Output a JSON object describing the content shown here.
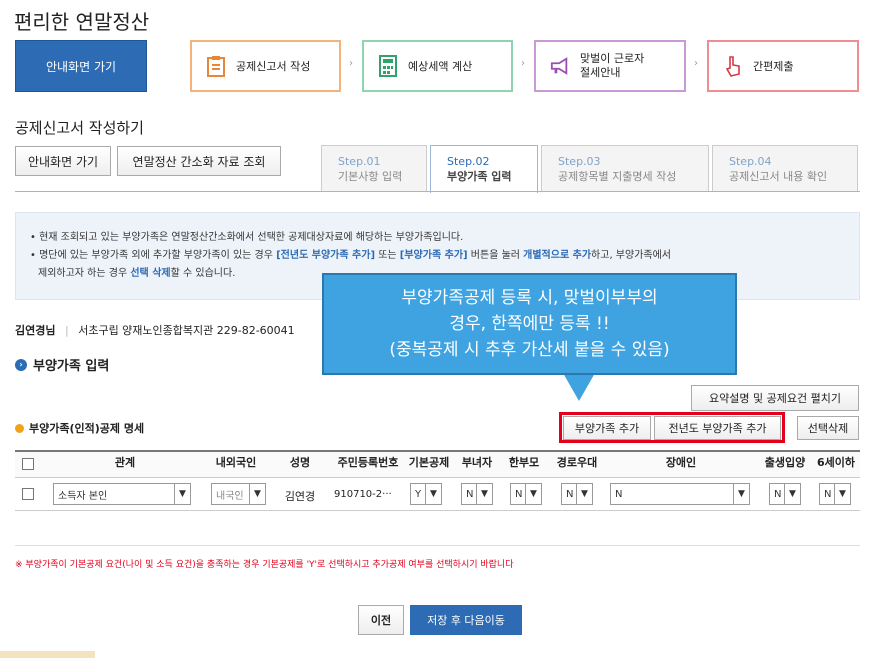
{
  "page_title": "편리한 연말정산",
  "home_button": "안내화면 가기",
  "top_steps": [
    {
      "label": "공제신고서 작성",
      "icon": "document-icon",
      "color": "#f5b27a"
    },
    {
      "label": "예상세액 계산",
      "icon": "calculator-icon",
      "color": "#8fd4b0"
    },
    {
      "label": "맞벌이 근로자\n절세안내",
      "icon": "megaphone-icon",
      "color": "#c99ad6"
    },
    {
      "label": "간편제출",
      "icon": "pointer-hand-icon",
      "color": "#ef8d93"
    }
  ],
  "section_title": "공제신고서 작성하기",
  "action_buttons": {
    "guide": "안내화면 가기",
    "lookup": "연말정산 간소화 자료 조회"
  },
  "tabs": [
    {
      "step": "Step.01",
      "label": "기본사항 입력",
      "active": false
    },
    {
      "step": "Step.02",
      "label": "부양가족 입력",
      "active": true
    },
    {
      "step": "Step.03",
      "label": "공제항목별 지출명세 작성",
      "active": false
    },
    {
      "step": "Step.04",
      "label": "공제신고서 내용 확인",
      "active": false
    }
  ],
  "info": {
    "line1": "현재 조회되고 있는 부양가족은 연말정산간소화에서 선택한 공제대상자료에 해당하는 부양가족입니다.",
    "line2_a": "명단에 있는 부양가족 외에 추가할 부양가족이 있는 경우 ",
    "line2_b": "[전년도 부양가족 추가]",
    "line2_c": " 또는 ",
    "line2_d": "[부양가족 추가]",
    "line2_e": " 버튼을 눌러 ",
    "line2_f": "개별적으로 추가",
    "line2_g": "하고, 부양가족에서",
    "line3_a": "제외하고자 하는 경우 ",
    "line3_b": "선택 삭제",
    "line3_c": "할 수 있습니다."
  },
  "callout": {
    "line1": "부양가족공제 등록 시, 맞벌이부부의",
    "line2": "경우, 한쪽에만 등록 !!",
    "line3": "(중복공제 시 추후 가산세 붙을 수 있음)"
  },
  "user": {
    "name": "김연경님",
    "company": "서초구립 양재노인종합복지관 229-82-60041"
  },
  "dependents_heading": "부양가족 입력",
  "summary_button": "요약설명 및 공제요건 펼치기",
  "table_title": "부양가족(인적)공제 명세",
  "table_buttons": {
    "add": "부양가족 추가",
    "add_prev": "전년도 부양가족 추가",
    "delete": "선택삭제"
  },
  "columns": [
    "관계",
    "내외국인",
    "성명",
    "주민등록번호",
    "기본공제",
    "부녀자",
    "한부모",
    "경로우대",
    "장애인",
    "출생입양",
    "6세이하"
  ],
  "row": {
    "relation": "소득자 본인",
    "nationality": "내국인",
    "name": "김연경",
    "rrn": "910710-2···",
    "basic": "Y",
    "woman": "N",
    "single_parent": "N",
    "elderly": "N",
    "disabled": "N",
    "birth": "N",
    "under6": "N"
  },
  "notice": "※ 부양가족이 기본공제 요건(나이 및 소득 요건)을 충족하는 경우 기본공제를 'Y'로 선택하시고 추가공제 여부를 선택하시기 바랍니다",
  "prev_button": "이전",
  "next_button": "저장 후 다음이동"
}
